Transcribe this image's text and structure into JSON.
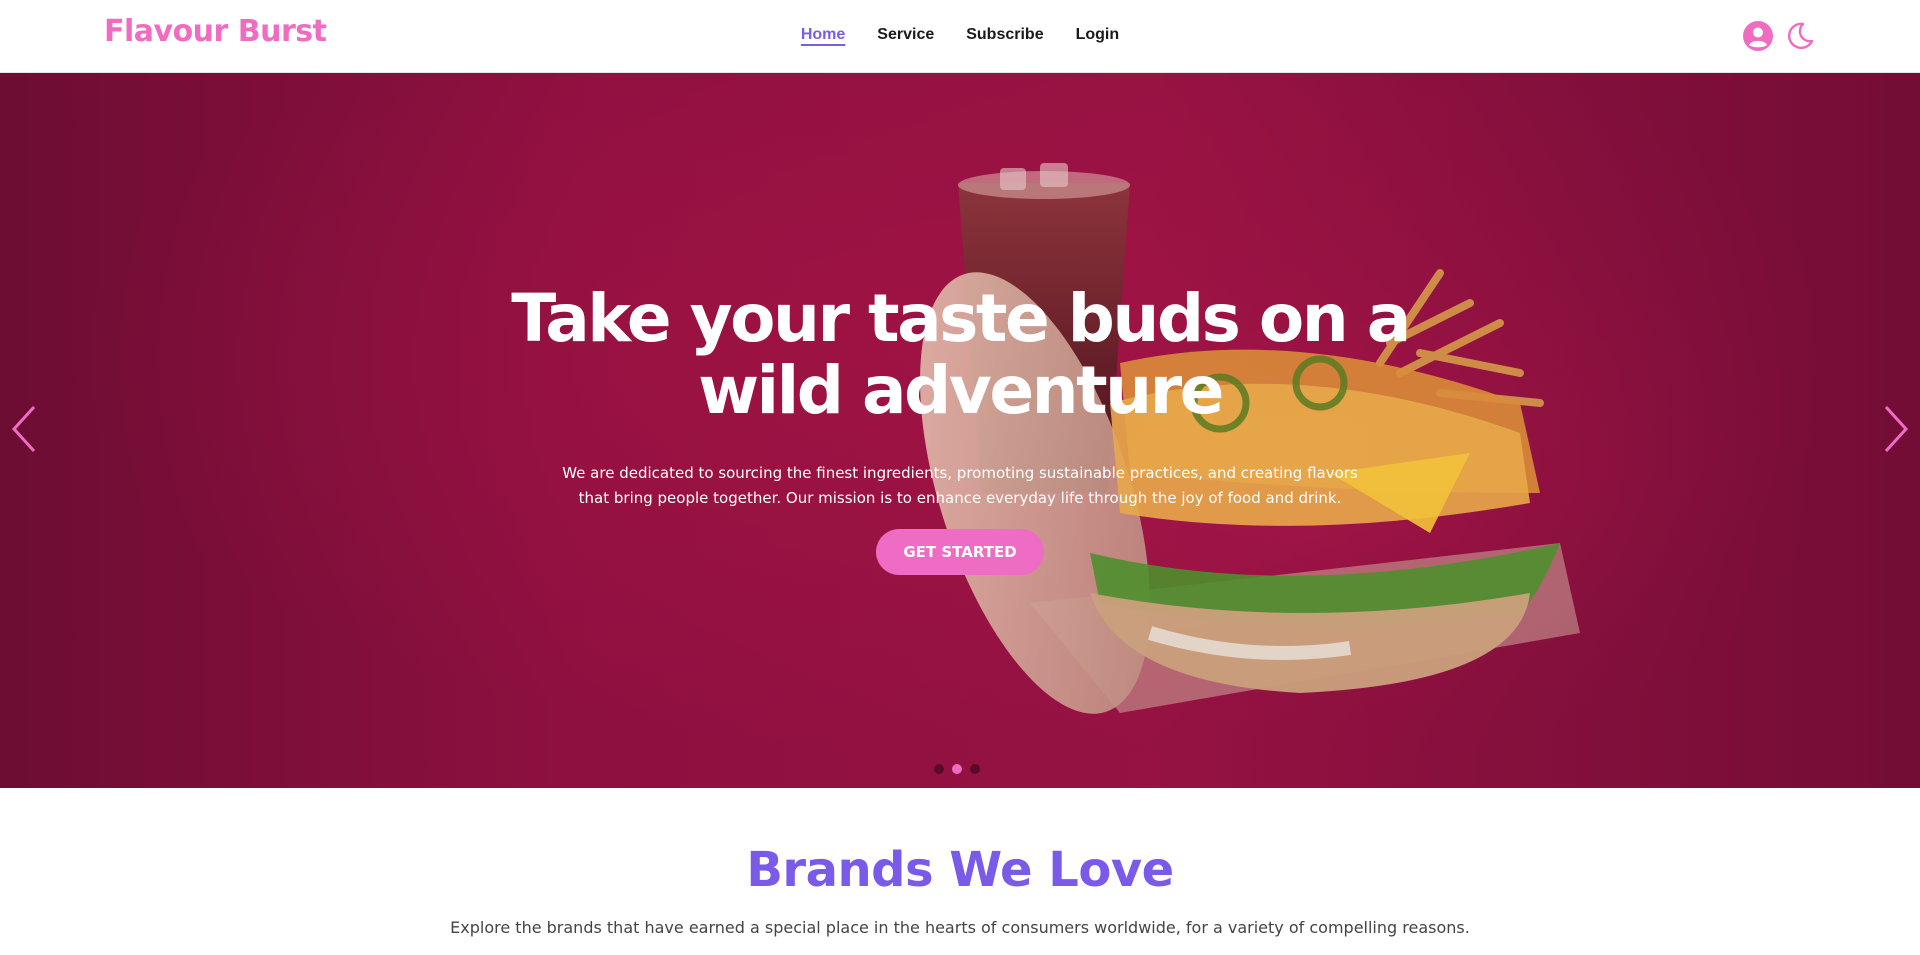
{
  "navbar": {
    "brand": "Flavour Burst",
    "links": [
      "Home",
      "Service",
      "Subscribe",
      "Login"
    ],
    "active_link": "Home",
    "icons": [
      "user-circle-icon",
      "moon-icon"
    ]
  },
  "hero": {
    "title": "Take your taste buds on a wild adventure",
    "text": "We are dedicated to sourcing the finest ingredients, promoting sustainable practices, and creating flavors that bring people together. Our mission is to enhance everyday life through the joy of food and drink.",
    "button_label": "GET STARTED",
    "slides": 3,
    "active_slide": 2
  },
  "brands": {
    "title": "Brands We Love",
    "subtitle": "Explore the brands that have earned a special place in the hearts of consumers worldwide, for a variety of compelling reasons."
  },
  "colors": {
    "brand_pink": "#f06cc0",
    "accent_purple": "#7b5ce6",
    "hero_bg": "#8e1040",
    "button_pink": "#ee6cc4"
  }
}
